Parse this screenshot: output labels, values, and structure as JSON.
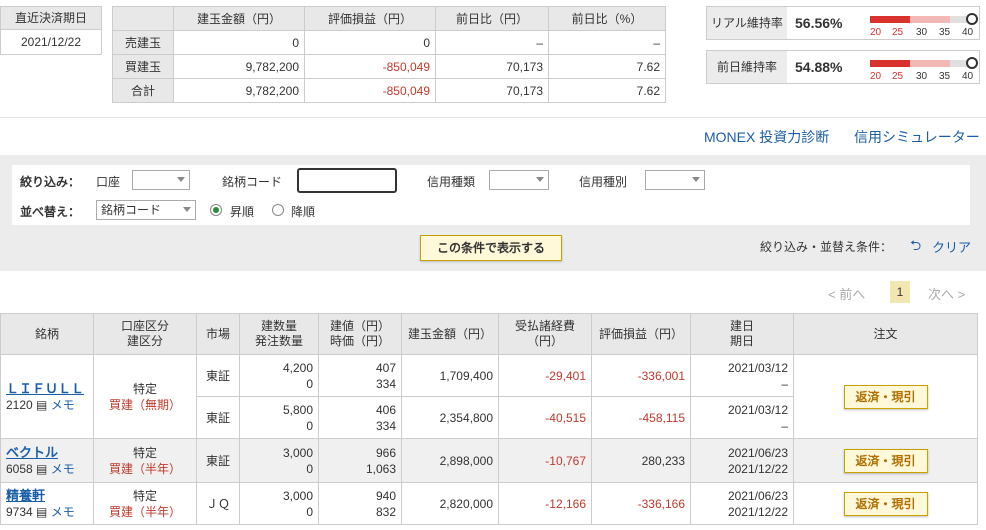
{
  "settlement": {
    "label": "直近決済期日",
    "date": "2021/12/22"
  },
  "summary": {
    "headers": [
      "",
      "建玉金額（円）",
      "評価損益（円）",
      "前日比（円）",
      "前日比（%）"
    ],
    "rows": [
      {
        "label": "売建玉",
        "amount": "0",
        "pl": "0",
        "diff": "–",
        "pct": "–"
      },
      {
        "label": "買建玉",
        "amount": "9,782,200",
        "pl": "-850,049",
        "diff": "70,173",
        "pct": "7.62"
      },
      {
        "label": "合計",
        "amount": "9,782,200",
        "pl": "-850,049",
        "diff": "70,173",
        "pct": "7.62"
      }
    ]
  },
  "maintenance": [
    {
      "label": "リアル維持率",
      "value": "56.56%",
      "level": 56.56
    },
    {
      "label": "前日維持率",
      "value": "54.88%",
      "level": 54.88
    }
  ],
  "gauge_ticks": [
    "20",
    "25",
    "30",
    "35",
    "40"
  ],
  "gauge_colors": {
    "red": "#d9312b",
    "pink": "#f2b8b5",
    "gray": "#e0e0e0"
  },
  "links": {
    "monex": "MONEX 投資力診断",
    "simulator": "信用シミュレーター"
  },
  "filter": {
    "narrow_label": "絞り込み：",
    "account_label": "口座",
    "code_label": "銘柄コード",
    "credit_type_label": "信用種類",
    "credit_kind_label": "信用種別",
    "sort_label": "並べ替え：",
    "sort_value": "銘柄コード",
    "asc": "昇順",
    "desc": "降順",
    "show_button": "この条件で表示する",
    "condition_label": "絞り込み・並替え条件：",
    "clear": "クリア"
  },
  "pager": {
    "prev": "< 前へ",
    "page": "1",
    "next": "次へ >"
  },
  "table": {
    "headers": {
      "symbol": "銘柄",
      "account": [
        "口座区分",
        "建区分"
      ],
      "market": "市場",
      "qty": [
        "建数量",
        "発注数量"
      ],
      "price": [
        "建値（円）",
        "時価（円）"
      ],
      "amount": "建玉金額（円）",
      "fee": [
        "受払諸経費",
        "（円）"
      ],
      "pl": "評価損益（円）",
      "date": [
        "建日",
        "期日"
      ],
      "order": "注文"
    },
    "memo": "メモ",
    "action": "返済・現引",
    "groups": [
      {
        "name": "ＬＩＦＵＬＬ",
        "code": "2120",
        "acct1": "特定",
        "acct2": "買建（無期）",
        "rows": [
          {
            "market": "東証",
            "qty": "4,200",
            "oqty": "0",
            "price": "407",
            "cur": "334",
            "amount": "1,709,400",
            "fee": "-29,401",
            "pl": "-336,001",
            "d1": "2021/03/12",
            "d2": "–"
          },
          {
            "market": "東証",
            "qty": "5,800",
            "oqty": "0",
            "price": "406",
            "cur": "334",
            "amount": "2,354,800",
            "fee": "-40,515",
            "pl": "-458,115",
            "d1": "2021/03/12",
            "d2": "–"
          }
        ]
      },
      {
        "name": "ベクトル",
        "code": "6058",
        "acct1": "特定",
        "acct2": "買建（半年）",
        "rows": [
          {
            "market": "東証",
            "qty": "3,000",
            "oqty": "0",
            "price": "966",
            "cur": "1,063",
            "amount": "2,898,000",
            "fee": "-10,767",
            "pl": "280,233",
            "d1": "2021/06/23",
            "d2": "2021/12/22"
          }
        ]
      },
      {
        "name": "精養軒",
        "code": "9734",
        "acct1": "特定",
        "acct2": "買建（半年）",
        "rows": [
          {
            "market": "ＪＱ",
            "qty": "3,000",
            "oqty": "0",
            "price": "940",
            "cur": "832",
            "amount": "2,820,000",
            "fee": "-12,166",
            "pl": "-336,166",
            "d1": "2021/06/23",
            "d2": "2021/12/22"
          }
        ]
      }
    ]
  }
}
